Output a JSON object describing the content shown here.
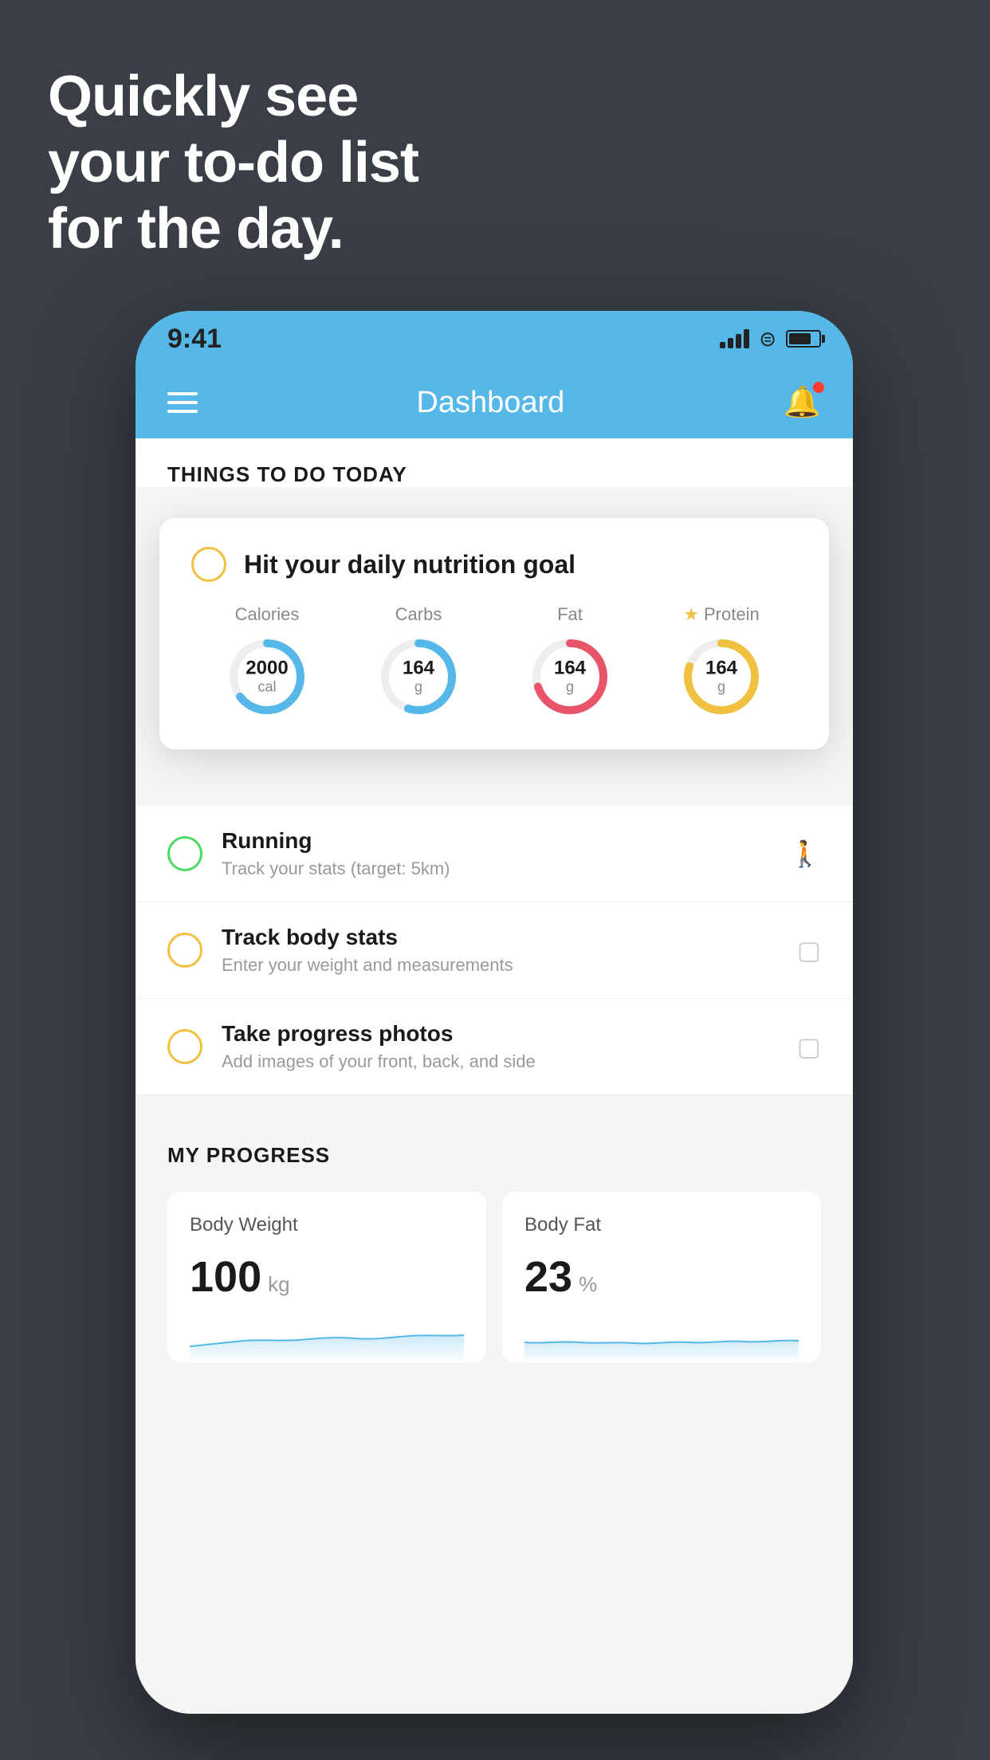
{
  "hero": {
    "line1": "Quickly see",
    "line2": "your to-do list",
    "line3": "for the day."
  },
  "status_bar": {
    "time": "9:41"
  },
  "header": {
    "title": "Dashboard"
  },
  "things_section": {
    "title": "THINGS TO DO TODAY"
  },
  "nutrition_card": {
    "title": "Hit your daily nutrition goal",
    "stats": [
      {
        "label": "Calories",
        "value": "2000",
        "unit": "cal",
        "color": "#55b8e8",
        "percent": 65
      },
      {
        "label": "Carbs",
        "value": "164",
        "unit": "g",
        "color": "#55b8e8",
        "percent": 55
      },
      {
        "label": "Fat",
        "value": "164",
        "unit": "g",
        "color": "#e8556a",
        "percent": 70
      },
      {
        "label": "Protein",
        "value": "164",
        "unit": "g",
        "color": "#f0c040",
        "percent": 80,
        "star": true
      }
    ]
  },
  "todo_items": [
    {
      "title": "Running",
      "subtitle": "Track your stats (target: 5km)",
      "circle_color": "green",
      "icon": "shoe"
    },
    {
      "title": "Track body stats",
      "subtitle": "Enter your weight and measurements",
      "circle_color": "yellow",
      "icon": "scale"
    },
    {
      "title": "Take progress photos",
      "subtitle": "Add images of your front, back, and side",
      "circle_color": "yellow-2",
      "icon": "photo"
    }
  ],
  "progress_section": {
    "title": "MY PROGRESS",
    "cards": [
      {
        "title": "Body Weight",
        "value": "100",
        "unit": "kg"
      },
      {
        "title": "Body Fat",
        "value": "23",
        "unit": "%"
      }
    ]
  }
}
